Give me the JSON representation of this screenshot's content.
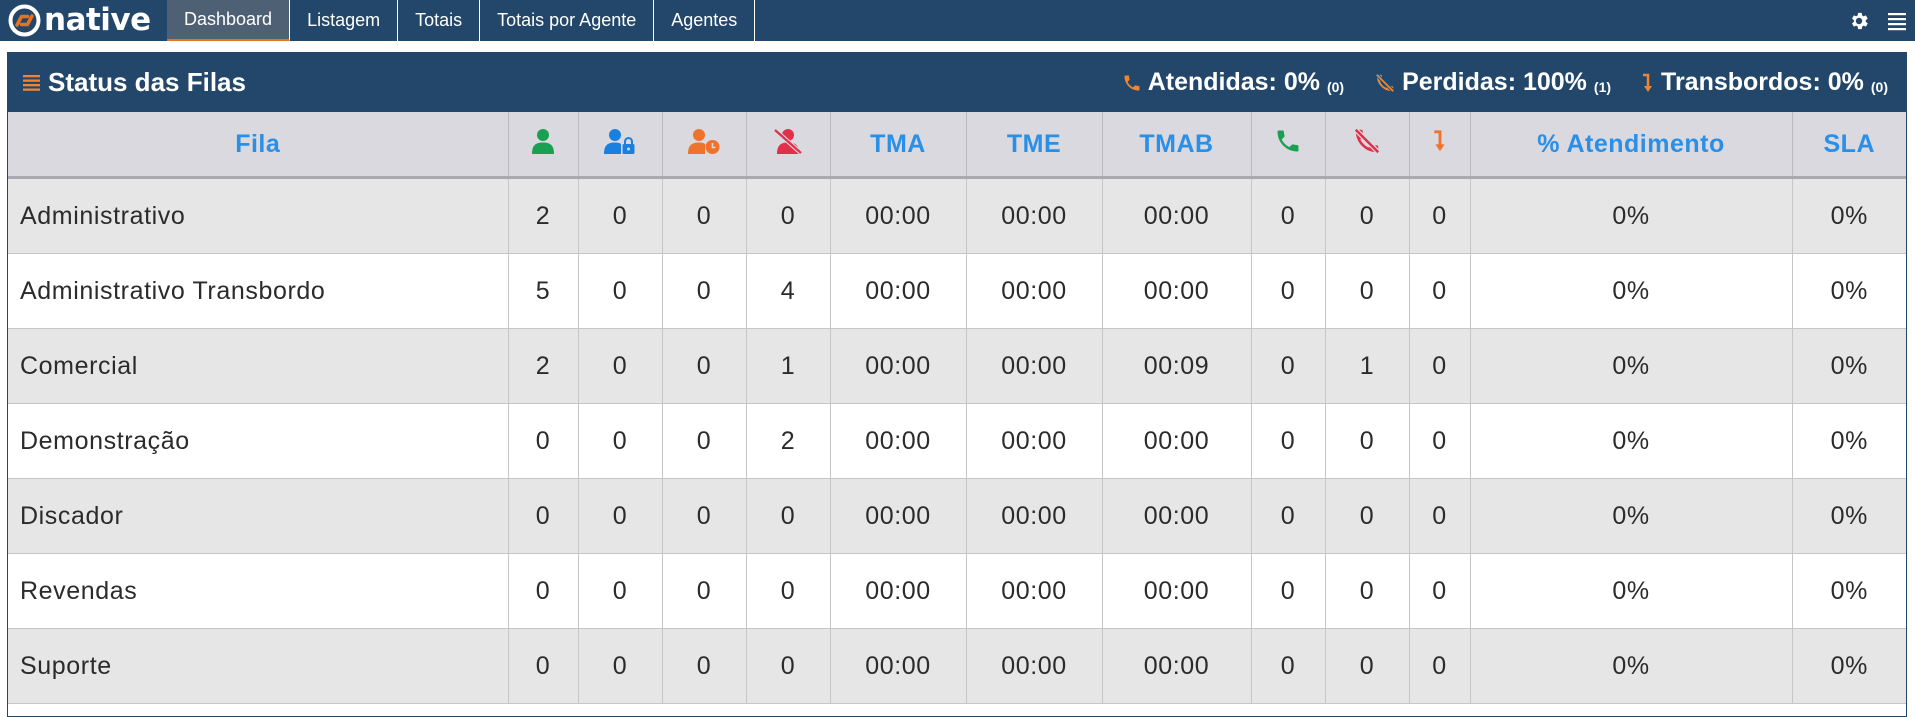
{
  "app": {
    "logo_text": "native"
  },
  "nav": {
    "tabs": [
      {
        "label": "Dashboard",
        "active": true
      },
      {
        "label": "Listagem"
      },
      {
        "label": "Totais"
      },
      {
        "label": "Totais por Agente"
      },
      {
        "label": "Agentes"
      }
    ],
    "icons": [
      "gear-icon",
      "menu-icon"
    ]
  },
  "panel": {
    "title": "Status das Filas",
    "stats": {
      "atendidas": {
        "label": "Atendidas: 0%",
        "count": "(0)",
        "icon": "phone-icon",
        "color": "#f0852d"
      },
      "perdidas": {
        "label": "Perdidas: 100%",
        "count": "(1)",
        "icon": "phone-missed-icon",
        "color": "#f0852d"
      },
      "transbordos": {
        "label": "Transbordos: 0%",
        "count": "(0)",
        "icon": "arrow-turn-down-icon",
        "color": "#f0852d"
      }
    }
  },
  "table": {
    "headers": {
      "fila": "Fila",
      "available_icon": "user-icon",
      "locked_icon": "user-lock-icon",
      "paused_icon": "user-clock-icon",
      "offline_icon": "user-slash-icon",
      "tma": "TMA",
      "tme": "TME",
      "tmab": "TMAB",
      "answered_icon": "phone-icon",
      "missed_icon": "phone-missed-icon",
      "transfer_icon": "arrow-turn-down-icon",
      "atendimento": "% Atendimento",
      "sla": "SLA"
    },
    "header_colors": {
      "text": "#2a8fe6",
      "green": "#1aa052",
      "blue": "#1a80e0",
      "orange": "#f0732d",
      "red": "#e0304a"
    },
    "rows": [
      {
        "name": "Administrativo",
        "c1": "2",
        "c2": "0",
        "c3": "0",
        "c4": "0",
        "tma": "00:00",
        "tme": "00:00",
        "tmab": "00:00",
        "ans": "0",
        "miss": "0",
        "transf": "0",
        "pct": "0%",
        "sla": "0%"
      },
      {
        "name": "Administrativo Transbordo",
        "c1": "5",
        "c2": "0",
        "c3": "0",
        "c4": "4",
        "tma": "00:00",
        "tme": "00:00",
        "tmab": "00:00",
        "ans": "0",
        "miss": "0",
        "transf": "0",
        "pct": "0%",
        "sla": "0%"
      },
      {
        "name": "Comercial",
        "c1": "2",
        "c2": "0",
        "c3": "0",
        "c4": "1",
        "tma": "00:00",
        "tme": "00:00",
        "tmab": "00:09",
        "ans": "0",
        "miss": "1",
        "transf": "0",
        "pct": "0%",
        "sla": "0%"
      },
      {
        "name": "Demonstração",
        "c1": "0",
        "c2": "0",
        "c3": "0",
        "c4": "2",
        "tma": "00:00",
        "tme": "00:00",
        "tmab": "00:00",
        "ans": "0",
        "miss": "0",
        "transf": "0",
        "pct": "0%",
        "sla": "0%"
      },
      {
        "name": "Discador",
        "c1": "0",
        "c2": "0",
        "c3": "0",
        "c4": "0",
        "tma": "00:00",
        "tme": "00:00",
        "tmab": "00:00",
        "ans": "0",
        "miss": "0",
        "transf": "0",
        "pct": "0%",
        "sla": "0%"
      },
      {
        "name": "Revendas",
        "c1": "0",
        "c2": "0",
        "c3": "0",
        "c4": "0",
        "tma": "00:00",
        "tme": "00:00",
        "tmab": "00:00",
        "ans": "0",
        "miss": "0",
        "transf": "0",
        "pct": "0%",
        "sla": "0%"
      },
      {
        "name": "Suporte",
        "c1": "0",
        "c2": "0",
        "c3": "0",
        "c4": "0",
        "tma": "00:00",
        "tme": "00:00",
        "tmab": "00:00",
        "ans": "0",
        "miss": "0",
        "transf": "0",
        "pct": "0%",
        "sla": "0%"
      }
    ]
  }
}
